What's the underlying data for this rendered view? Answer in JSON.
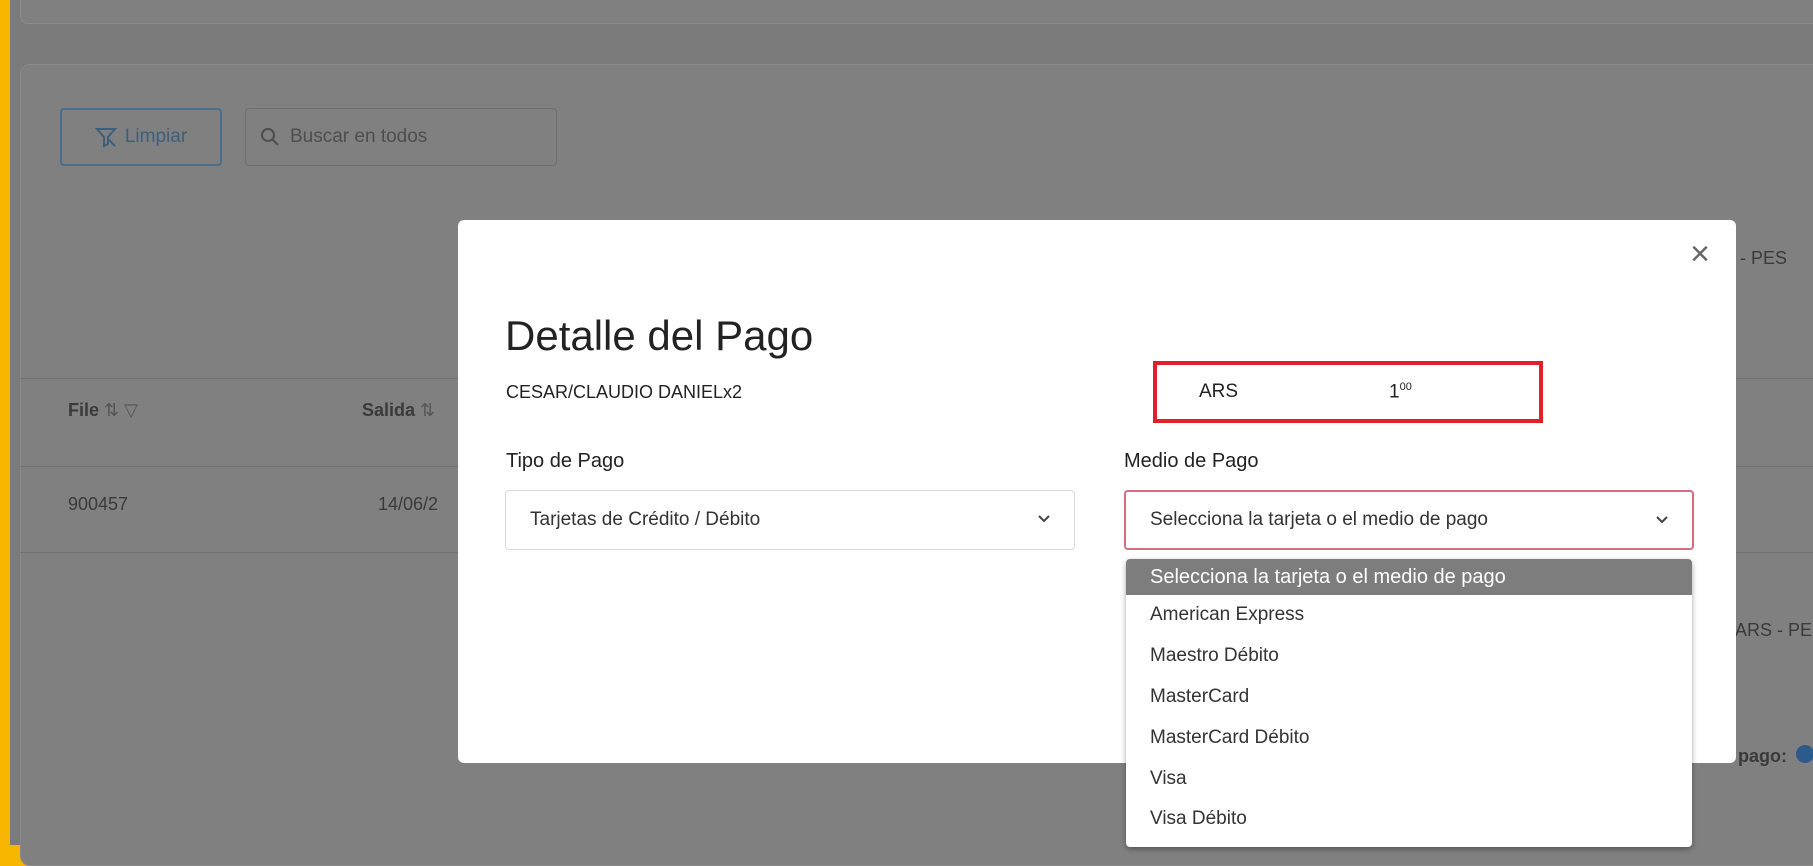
{
  "background": {
    "clear_button_label": "Limpiar",
    "search_placeholder": "Buscar en todos",
    "col_file": "File",
    "col_salida": "Salida",
    "row_file": "900457",
    "row_salida": "14/06/2",
    "currency_right_1": "RS - PES",
    "currency_right_2": "ARS - PE",
    "pago_label": "pago:"
  },
  "modal": {
    "title": "Detalle del Pago",
    "passenger": "CESAR/CLAUDIO DANIELx2",
    "currency": "ARS",
    "amount_int": "1",
    "amount_dec": "00",
    "tipo_label": "Tipo de Pago",
    "tipo_value": "Tarjetas de Crédito / Débito",
    "medio_label": "Medio de Pago",
    "medio_value": "Selecciona la tarjeta o el medio de pago",
    "options": [
      "Selecciona la tarjeta o el medio de pago",
      "American Express",
      "Maestro Débito",
      "MasterCard",
      "MasterCard Débito",
      "Visa",
      "Visa Débito"
    ]
  },
  "colors": {
    "frame_border": "#f7b500",
    "highlight": "#e0202a",
    "focus_border": "#d96b7e"
  }
}
